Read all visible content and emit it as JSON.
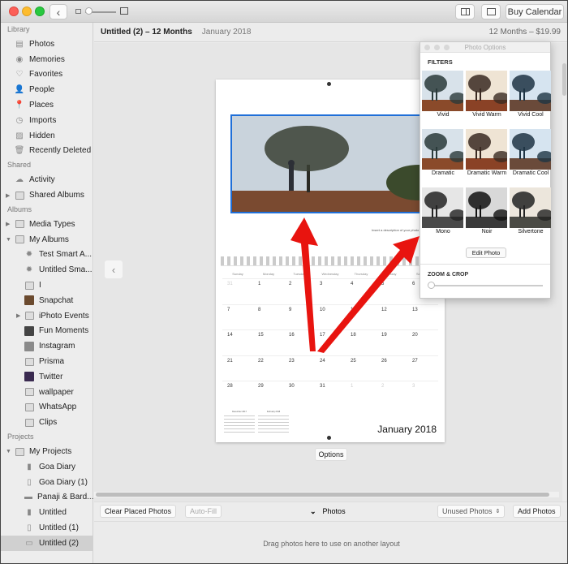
{
  "window": {
    "toolbar": {
      "back_label": "‹",
      "buy_calendar_label": "Buy Calendar"
    },
    "header": {
      "title": "Untitled (2) – 12 Months",
      "subtitle": "January 2018",
      "price": "12 Months – $19.99"
    }
  },
  "sidebar": {
    "sections": [
      {
        "label": "Library",
        "items": [
          {
            "label": "Photos",
            "icon": "photos-icon"
          },
          {
            "label": "Memories",
            "icon": "memories-icon"
          },
          {
            "label": "Favorites",
            "icon": "heart-icon"
          },
          {
            "label": "People",
            "icon": "person-icon"
          },
          {
            "label": "Places",
            "icon": "pin-icon"
          },
          {
            "label": "Imports",
            "icon": "clock-icon"
          },
          {
            "label": "Hidden",
            "icon": "hidden-icon"
          },
          {
            "label": "Recently Deleted",
            "icon": "trash-icon"
          }
        ]
      },
      {
        "label": "Shared",
        "items": [
          {
            "label": "Activity",
            "icon": "cloud-icon"
          },
          {
            "label": "Shared Albums",
            "icon": "album-icon"
          }
        ]
      },
      {
        "label": "Albums",
        "items": [
          {
            "label": "Media Types",
            "icon": "album-icon"
          },
          {
            "label": "My Albums",
            "icon": "album-icon"
          },
          {
            "label": "Test Smart A...",
            "icon": "gear-icon"
          },
          {
            "label": "Untitled Sma...",
            "icon": "gear-icon"
          },
          {
            "label": "I",
            "icon": "album-icon"
          },
          {
            "label": "Snapchat",
            "icon": "thumbnail-icon"
          },
          {
            "label": "iPhoto Events",
            "icon": "folder-icon"
          },
          {
            "label": "Fun Moments",
            "icon": "thumbnail-icon"
          },
          {
            "label": "Instagram",
            "icon": "thumbnail-icon"
          },
          {
            "label": "Prisma",
            "icon": "album-icon"
          },
          {
            "label": "Twitter",
            "icon": "thumbnail-icon"
          },
          {
            "label": "wallpaper",
            "icon": "album-icon"
          },
          {
            "label": "WhatsApp",
            "icon": "album-icon"
          },
          {
            "label": "Clips",
            "icon": "album-icon"
          }
        ]
      },
      {
        "label": "Projects",
        "items": [
          {
            "label": "My Projects",
            "icon": "album-icon"
          },
          {
            "label": "Goa Diary",
            "icon": "book-icon"
          },
          {
            "label": "Goa Diary (1)",
            "icon": "card-icon"
          },
          {
            "label": "Panaji & Bard...",
            "icon": "slideshow-icon"
          },
          {
            "label": "Untitled",
            "icon": "book-icon"
          },
          {
            "label": "Untitled (1)",
            "icon": "card-icon"
          },
          {
            "label": "Untitled (2)",
            "icon": "calendar-icon"
          }
        ]
      }
    ],
    "selected": "Untitled (2)"
  },
  "calendar_page": {
    "caption": "Insert a description of your photo",
    "weekdays": [
      "Sunday",
      "Monday",
      "Tuesday",
      "Wednesday",
      "Thursday",
      "Friday",
      "Saturday"
    ],
    "weeks": [
      [
        "31",
        "1",
        "2",
        "3",
        "4",
        "5",
        "6"
      ],
      [
        "7",
        "8",
        "9",
        "10",
        "11",
        "12",
        "13"
      ],
      [
        "14",
        "15",
        "16",
        "17",
        "18",
        "19",
        "20"
      ],
      [
        "21",
        "22",
        "23",
        "24",
        "25",
        "26",
        "27"
      ],
      [
        "28",
        "29",
        "30",
        "31",
        "1",
        "2",
        "3"
      ]
    ],
    "dim_days": [
      [
        0,
        0
      ],
      [
        4,
        4
      ],
      [
        4,
        5
      ],
      [
        4,
        6
      ]
    ],
    "mini_prev": "December 2017",
    "mini_next": "February 2018",
    "month_title": "January 2018",
    "options_label": "Options"
  },
  "photo_options": {
    "title": "Photo Options",
    "filters_label": "FILTERS",
    "filters": [
      {
        "label": "Vivid",
        "tone": "vivid"
      },
      {
        "label": "Vivid Warm",
        "tone": "warm"
      },
      {
        "label": "Vivid Cool",
        "tone": "cool"
      },
      {
        "label": "Dramatic",
        "tone": "vivid"
      },
      {
        "label": "Dramatic Warm",
        "tone": "warm"
      },
      {
        "label": "Dramatic Cool",
        "tone": "cool"
      },
      {
        "label": "Mono",
        "tone": "mono"
      },
      {
        "label": "Noir",
        "tone": "noir"
      },
      {
        "label": "Silvertone",
        "tone": "silver"
      }
    ],
    "edit_label": "Edit Photo",
    "zoom_crop_label": "ZOOM & CROP",
    "zoom_value": 0
  },
  "bottom_bar": {
    "clear_label": "Clear Placed Photos",
    "autofill_label": "Auto-Fill",
    "photos_label": "Photos",
    "filter_select": "Unused Photos",
    "add_label": "Add Photos",
    "drop_hint": "Drag photos here to use on another layout"
  }
}
